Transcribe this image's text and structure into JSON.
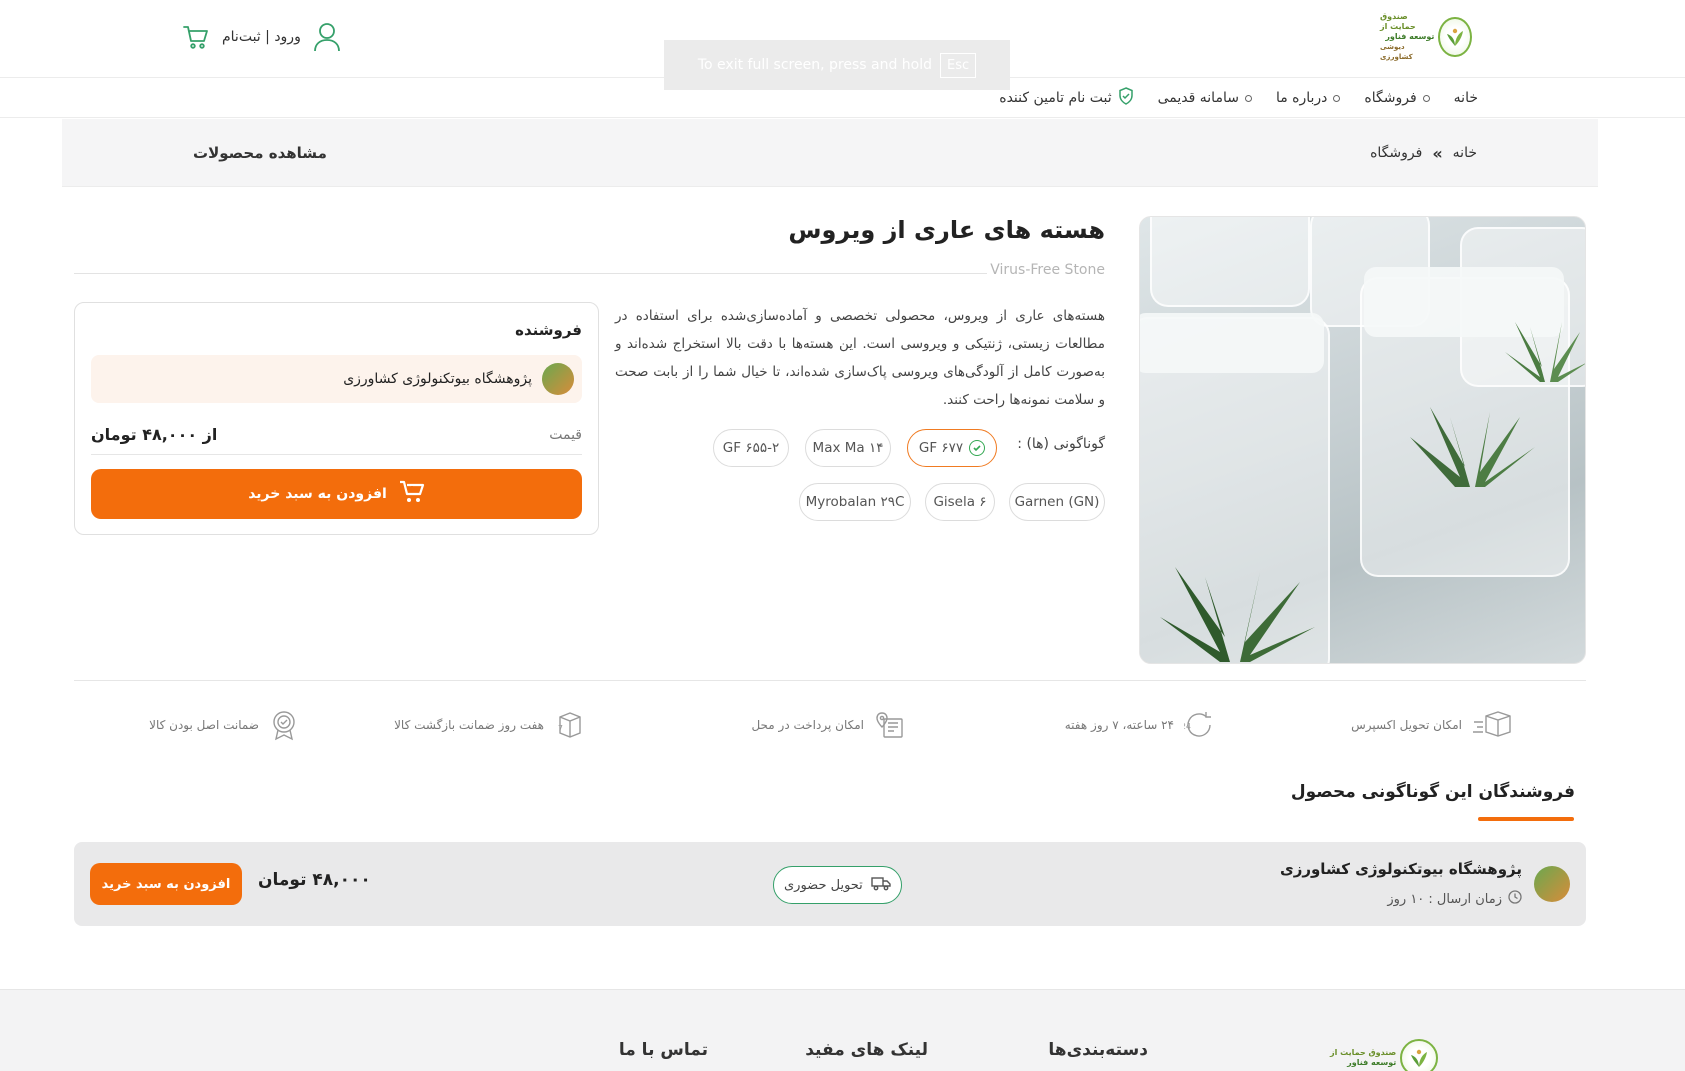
{
  "header": {
    "logo_lines": [
      "صندوق حمایت از",
      "توسعه فناور",
      "دیوشی کشاورزی"
    ],
    "account_label": "ورود | ثبت‌نام",
    "fullscreen_toast": "To exit full screen, press and hold",
    "fullscreen_key": "Esc"
  },
  "nav": {
    "items": [
      {
        "label": "خانه"
      },
      {
        "label": "فروشگاه"
      },
      {
        "label": "درباره ما"
      },
      {
        "label": "سامانه قدیمی"
      },
      {
        "label": "ثبت نام تامین کننده"
      }
    ]
  },
  "breadcrumb": {
    "home": "خانه",
    "separator": "»",
    "current": "فروشگاه",
    "page_title": "مشاهده محصولات"
  },
  "product": {
    "title": "هسته های عاری از ویروس",
    "latin_name": "Virus-Free Stone",
    "description": "هسته‌های عاری از ویروس، محصولی تخصصی و آماده‌سازی‌شده برای استفاده در مطالعات زیستی، ژنتیکی و ویروسی است. این هسته‌ها با دقت بالا استخراج شده‌اند و به‌صورت کامل از آلودگی‌های ویروسی پاک‌سازی شده‌اند، تا خیال شما را از بابت صحت و سلامت نمونه‌ها راحت کنند.",
    "variants_label": "گوناگونی (ها) :",
    "variants": [
      {
        "label": "GF ۶۷۷",
        "selected": true
      },
      {
        "label": "Max Ma ۱۴",
        "selected": false
      },
      {
        "label": "GF ۶۵۵-۲",
        "selected": false
      },
      {
        "label": "Garnen (GN)",
        "selected": false
      },
      {
        "label": "Gisela ۶",
        "selected": false
      },
      {
        "label": "Myrobalan ۲۹C",
        "selected": false
      }
    ]
  },
  "seller_box": {
    "title": "فروشنده",
    "seller_name": "پژوهشگاه بیوتکنولوژی کشاورزی",
    "price_label": "قیمت",
    "price_value": "از ۴۸,۰۰۰ تومان",
    "add_to_cart": "افزودن به سبد خرید"
  },
  "features": [
    {
      "icon": "express-delivery-icon",
      "label": "امکان تحویل اکسپرس"
    },
    {
      "icon": "support-24-7-icon",
      "label": "۲۴ ساعته، ۷ روز هفته"
    },
    {
      "icon": "cash-on-delivery-icon",
      "label": "امکان پرداخت در محل"
    },
    {
      "icon": "return-guarantee-icon",
      "label": "هفت روز ضمانت بازگشت کالا"
    },
    {
      "icon": "authenticity-badge-icon",
      "label": "ضمانت اصل بودن کالا"
    }
  ],
  "variant_sellers": {
    "title": "فروشندگان این گوناگونی محصول",
    "rows": [
      {
        "seller": "پژوهشگاه بیوتکنولوژی کشاورزی",
        "ship_time": "زمان ارسال : ۱۰ روز",
        "delivery": "تحویل حضوری",
        "price": "۴۸,۰۰۰ تومان",
        "add_to_cart": "افزودن به سبد خرید"
      }
    ]
  },
  "footer": {
    "columns": [
      "دسته‌بندی‌ها",
      "لینک های مفید",
      "تماس با ما"
    ],
    "logo_lines": [
      "صندوق حمایت از",
      "توسعه فناور"
    ]
  },
  "colors": {
    "accent": "#f36d0c",
    "green": "#34a853",
    "band": "#f5f5f6"
  }
}
